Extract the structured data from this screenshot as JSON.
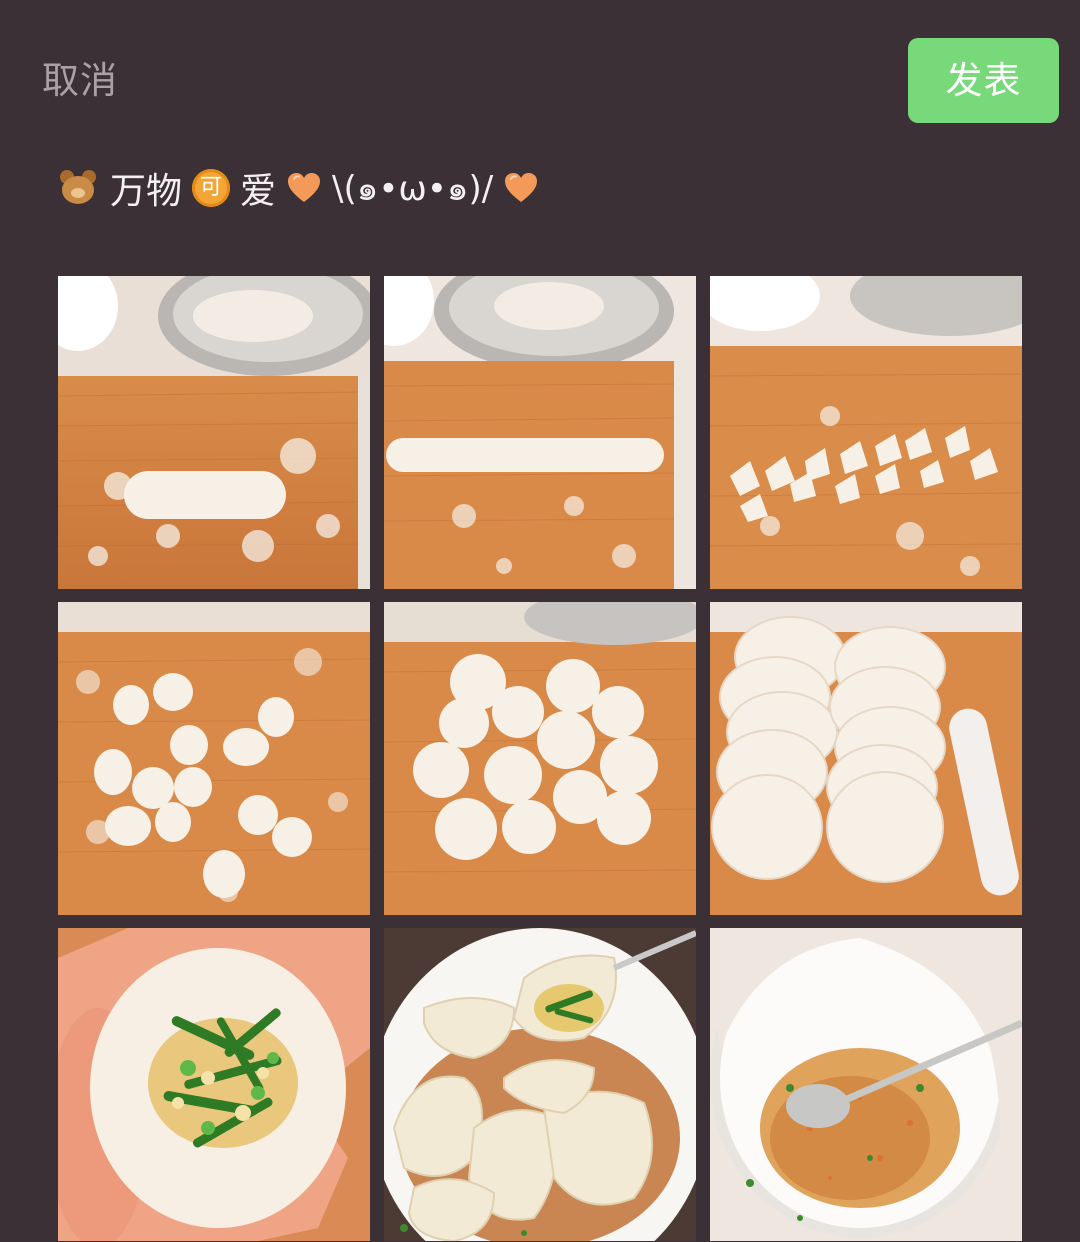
{
  "header": {
    "cancel_label": "取消",
    "publish_label": "发表"
  },
  "post": {
    "text_before": "万物",
    "badge_char": "可",
    "text_after": "爱",
    "kaomoji": "\\(๑•ω•๑)/"
  },
  "photos": [
    {
      "subject": "dough-log-on-board"
    },
    {
      "subject": "rolled-dough-rope"
    },
    {
      "subject": "cut-dough-pieces"
    },
    {
      "subject": "dough-pieces-scattered"
    },
    {
      "subject": "flattened-dough-discs"
    },
    {
      "subject": "stacked-wrappers-with-rolling-pin"
    },
    {
      "subject": "wrapper-with-chive-egg-filling"
    },
    {
      "subject": "cooked-dumplings-in-bowl"
    },
    {
      "subject": "dipping-sauce-with-spoon"
    }
  ],
  "colors": {
    "background": "#3a3035",
    "publish_button": "#78d97a",
    "cancel_text": "#a8a2a6",
    "caption_text": "#f4f0f2"
  }
}
